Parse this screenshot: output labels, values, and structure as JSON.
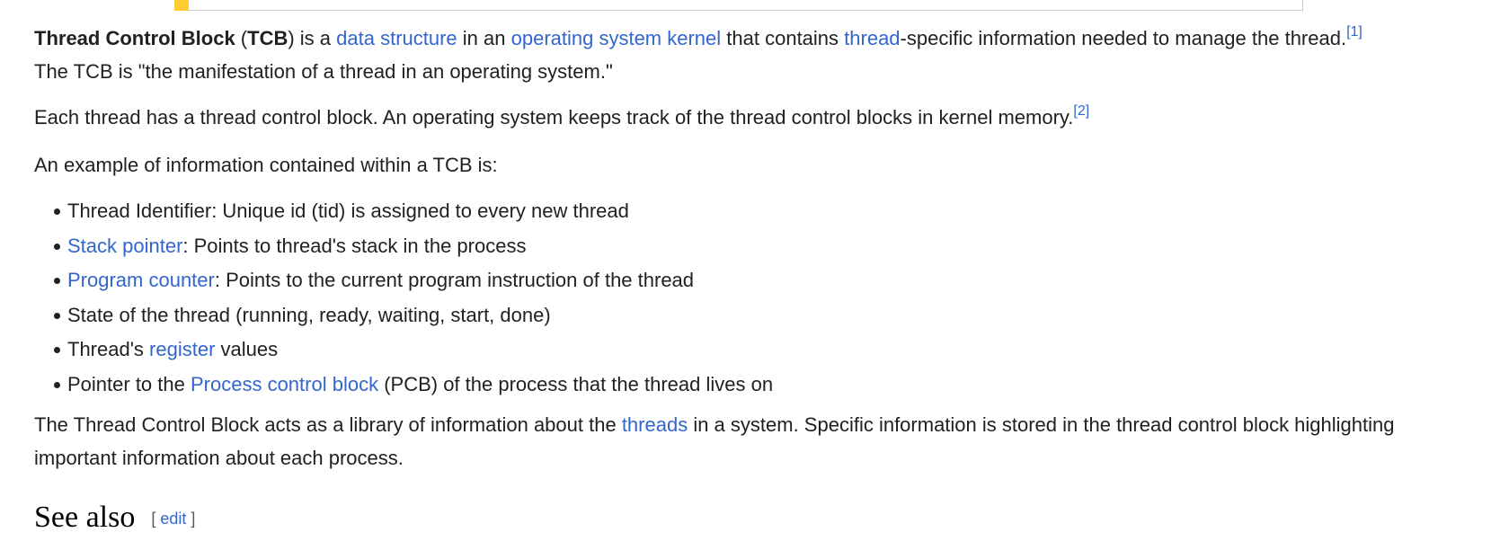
{
  "intro": {
    "bold_term": "Thread Control Block",
    "open_paren": " (",
    "bold_abbr": "TCB",
    "t1": ") is a ",
    "link_data_structure": "data structure",
    "t2": " in an ",
    "link_os_kernel": "operating system kernel",
    "t3": " that contains ",
    "link_thread": "thread",
    "t4": "-specific information needed to manage the thread.",
    "ref1": "[1]",
    "t5": "The TCB is \"the manifestation of a thread in an operating system.\""
  },
  "para2": {
    "text": "Each thread has a thread control block. An operating system keeps track of the thread control blocks in kernel memory.",
    "ref2": "[2]"
  },
  "para3": {
    "text": "An example of information contained within a TCB is:"
  },
  "list": {
    "item1": "Thread Identifier: Unique id (tid) is assigned to every new thread",
    "item2_link": "Stack pointer",
    "item2_rest": ": Points to thread's stack in the process",
    "item3_link": "Program counter",
    "item3_rest": ": Points to the current program instruction of the thread",
    "item4": "State of the thread (running, ready, waiting, start, done)",
    "item5_pre": "Thread's ",
    "item5_link": "register",
    "item5_rest": " values",
    "item6_pre": "Pointer to the ",
    "item6_link": "Process control block",
    "item6_rest": " (PCB) of the process that the thread lives on"
  },
  "para4": {
    "t1": "The Thread Control Block acts as a library of information about the ",
    "link_threads": "threads",
    "t2": " in a system. Specific information is stored in the thread control block highlighting important information about each process."
  },
  "see_also": {
    "heading": "See also",
    "bracket_open": "[ ",
    "edit": "edit",
    "bracket_close": " ]"
  },
  "colors": {
    "link": "#3366cc",
    "text": "#202122",
    "accent": "#fc3"
  }
}
